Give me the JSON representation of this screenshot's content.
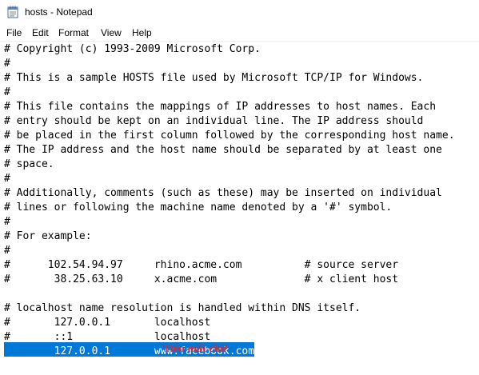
{
  "window": {
    "title": "hosts - Notepad",
    "app_icon": "notepad-icon"
  },
  "menu": {
    "items": [
      "File",
      "Edit",
      "Format",
      "View",
      "Help"
    ]
  },
  "editor": {
    "lines": [
      "# Copyright (c) 1993-2009 Microsoft Corp.",
      "#",
      "# This is a sample HOSTS file used by Microsoft TCP/IP for Windows.",
      "#",
      "# This file contains the mappings of IP addresses to host names. Each",
      "# entry should be kept on an individual line. The IP address should",
      "# be placed in the first column followed by the corresponding host name.",
      "# The IP address and the host name should be separated by at least one",
      "# space.",
      "#",
      "# Additionally, comments (such as these) may be inserted on individual",
      "# lines or following the machine name denoted by a '#' symbol.",
      "#",
      "# For example:",
      "#",
      "#      102.54.94.97     rhino.acme.com          # source server",
      "#       38.25.63.10     x.acme.com              # x client host",
      "",
      "# localhost name resolution is handled within DNS itself.",
      "#       127.0.0.1       localhost",
      "#       ::1             localhost",
      "        127.0.0.1       www.facebook.com"
    ],
    "selected_line_index": 21,
    "selection_color": "#0078d7"
  },
  "watermark": {
    "text": "Tiêu mất chữ"
  }
}
